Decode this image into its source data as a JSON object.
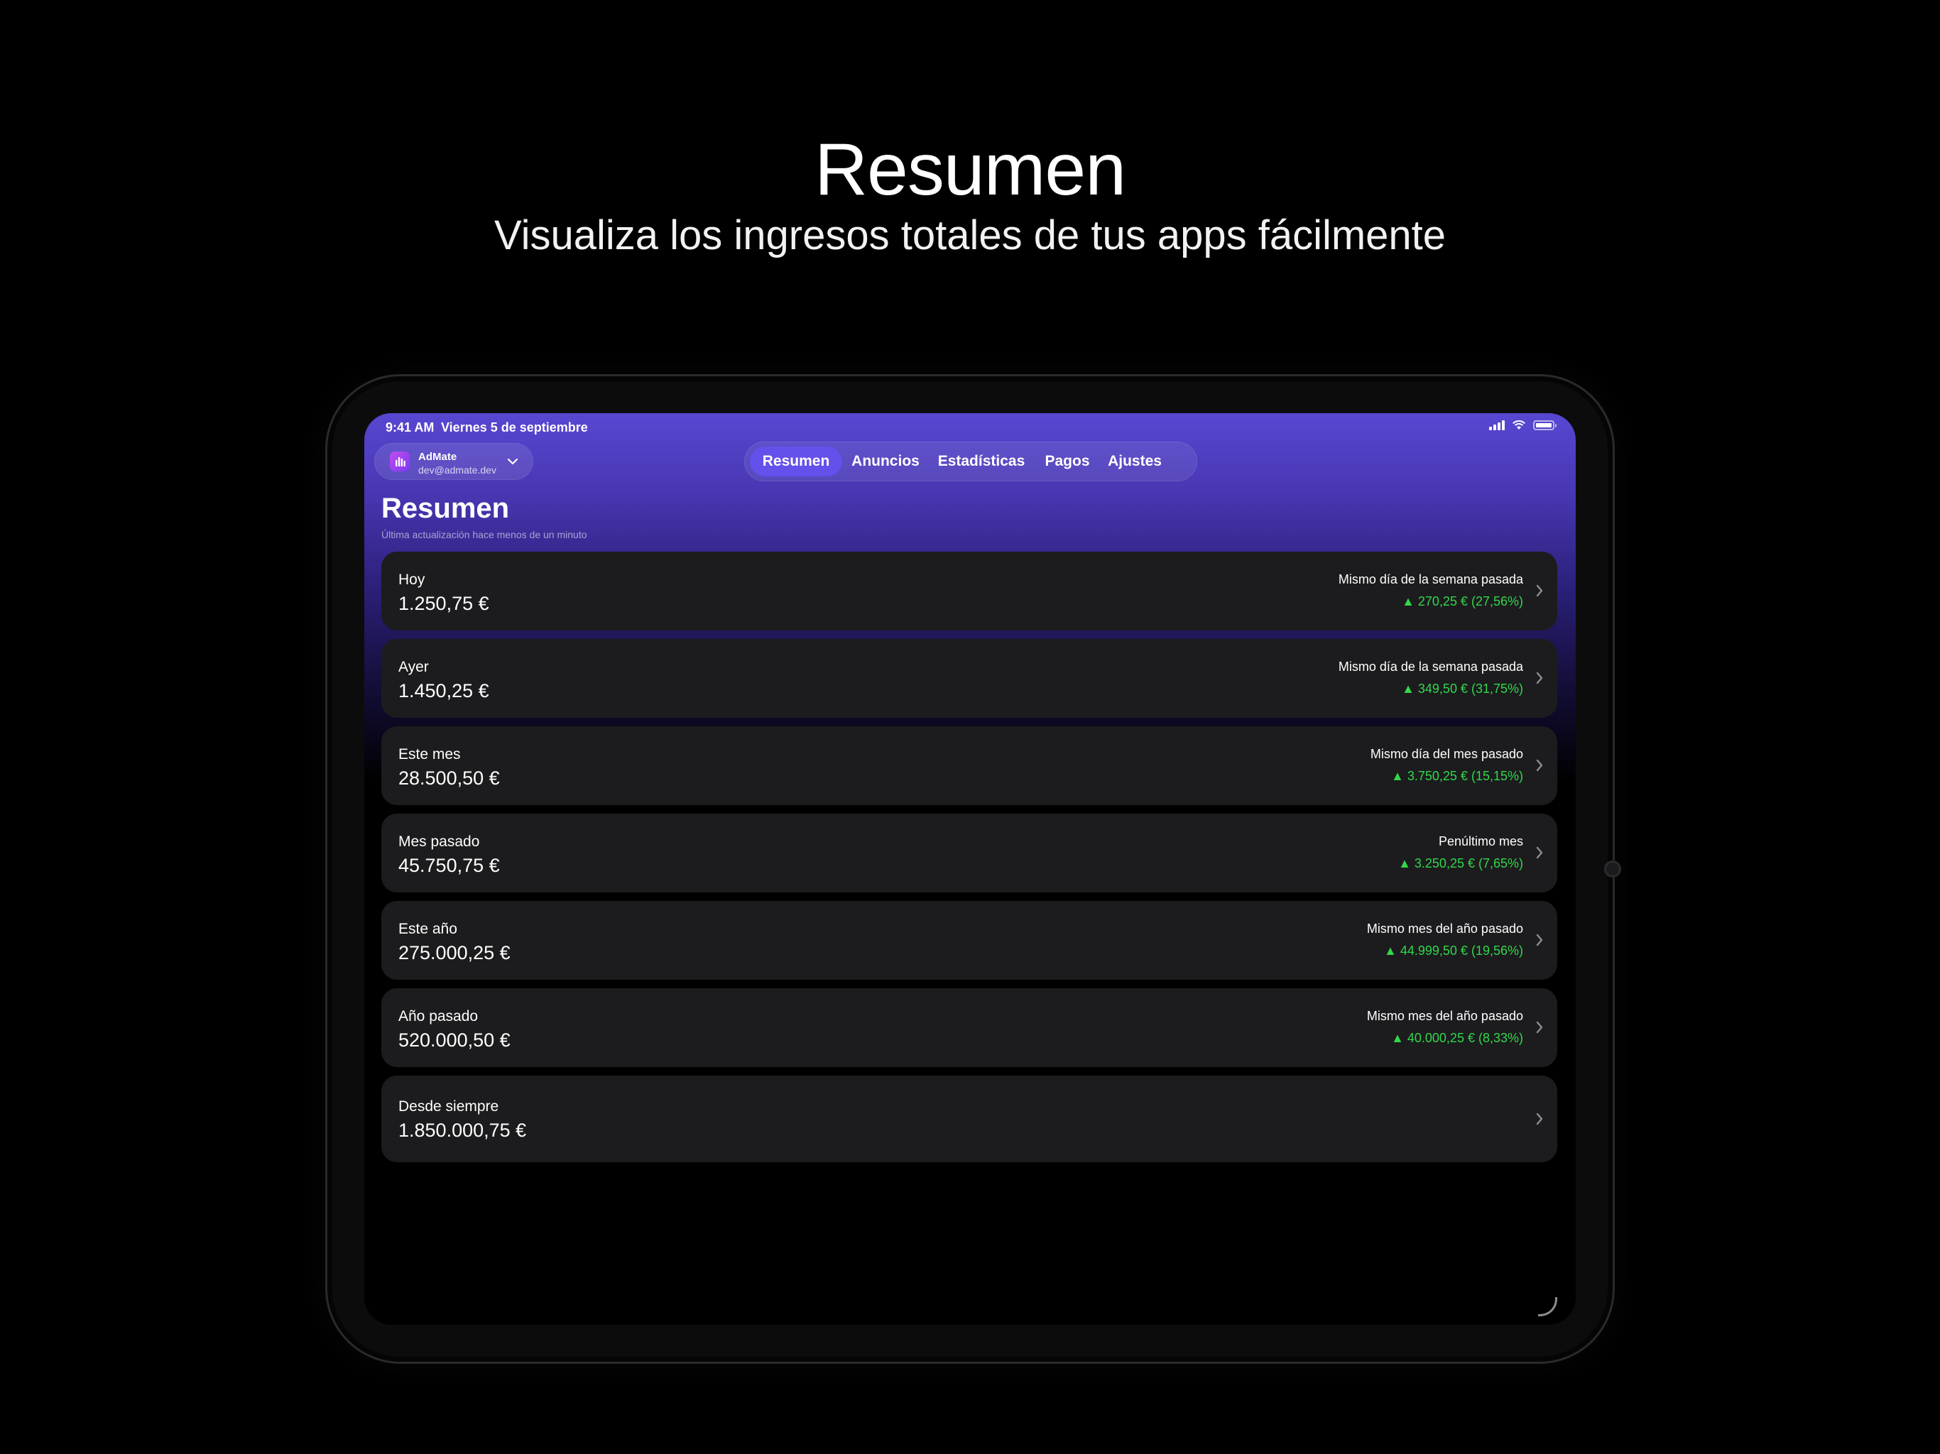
{
  "marketing": {
    "title": "Resumen",
    "subtitle": "Visualiza los ingresos totales de tus apps fácilmente"
  },
  "status_bar": {
    "time": "9:41 AM",
    "date": "Viernes 5 de septiembre"
  },
  "account": {
    "app_name": "AdMate",
    "email": "dev@admate.dev"
  },
  "tabs": [
    {
      "label": "Resumen",
      "active": true
    },
    {
      "label": "Anuncios",
      "active": false
    },
    {
      "label": "Estadísticas",
      "active": false
    },
    {
      "label": "Pagos",
      "active": false
    },
    {
      "label": "Ajustes",
      "active": false
    }
  ],
  "page": {
    "title": "Resumen",
    "subtitle": "Última actualización hace menos de un minuto"
  },
  "cards": [
    {
      "label": "Hoy",
      "value": "1.250,75 €",
      "compare": "Mismo día de la semana pasada",
      "delta": "▲ 270,25 € (27,56%)"
    },
    {
      "label": "Ayer",
      "value": "1.450,25 €",
      "compare": "Mismo día de la semana pasada",
      "delta": "▲ 349,50 € (31,75%)"
    },
    {
      "label": "Este mes",
      "value": "28.500,50 €",
      "compare": "Mismo día del mes pasado",
      "delta": "▲ 3.750,25 € (15,15%)"
    },
    {
      "label": "Mes pasado",
      "value": "45.750,75 €",
      "compare": "Penúltimo mes",
      "delta": "▲ 3.250,25 € (7,65%)"
    },
    {
      "label": "Este año",
      "value": "275.000,25 €",
      "compare": "Mismo mes del año pasado",
      "delta": "▲ 44.999,50 € (19,56%)"
    },
    {
      "label": "Año pasado",
      "value": "520.000,50 €",
      "compare": "Mismo mes del año pasado",
      "delta": "▲ 40.000,25 € (8,33%)"
    },
    {
      "label": "Desde siempre",
      "value": "1.850.000,75 €"
    }
  ],
  "colors": {
    "accent": "#6450ea",
    "positive": "#32d74b",
    "card_bg": "#1c1c1e"
  }
}
